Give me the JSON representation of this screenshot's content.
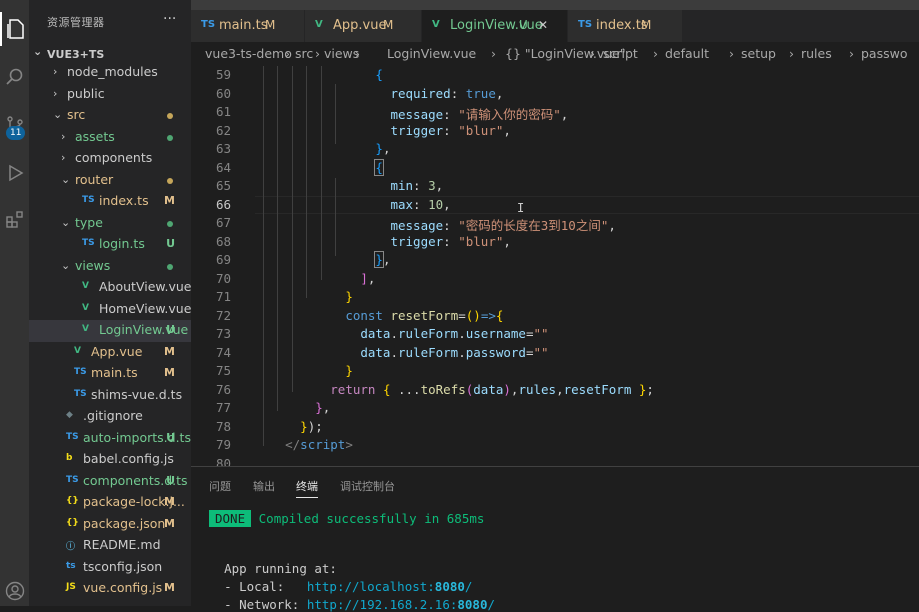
{
  "activity_bar": {
    "scm_badge": "11"
  },
  "sidebar": {
    "title": "资源管理器",
    "more": "···",
    "root": "VUE3+TS",
    "items": [
      {
        "label": "node_modules",
        "chevron": "›",
        "icon": "",
        "icon_color": "",
        "status": "",
        "dot": ""
      },
      {
        "label": "public",
        "chevron": "›",
        "icon": "",
        "icon_color": "",
        "status": "",
        "dot": ""
      },
      {
        "label": "src",
        "chevron": "⌄",
        "icon": "",
        "icon_color": "",
        "status": "",
        "dot": "#c5a65a"
      },
      {
        "label": "assets",
        "chevron": "›",
        "icon": "",
        "icon_color": "",
        "status": "",
        "dot": "#4fa672"
      },
      {
        "label": "components",
        "chevron": "›",
        "icon": "",
        "icon_color": "",
        "status": "",
        "dot": ""
      },
      {
        "label": "router",
        "chevron": "⌄",
        "icon": "",
        "icon_color": "",
        "status": "",
        "dot": "#c5a65a"
      },
      {
        "label": "index.ts",
        "chevron": "",
        "icon": "TS",
        "icon_color": "#3b9be8",
        "status": "M",
        "dot": ""
      },
      {
        "label": "type",
        "chevron": "⌄",
        "icon": "",
        "icon_color": "",
        "status": "",
        "dot": "#4fa672"
      },
      {
        "label": "login.ts",
        "chevron": "",
        "icon": "TS",
        "icon_color": "#3b9be8",
        "status": "U",
        "dot": ""
      },
      {
        "label": "views",
        "chevron": "⌄",
        "icon": "",
        "icon_color": "",
        "status": "",
        "dot": "#4fa672"
      },
      {
        "label": "AboutView.vue",
        "chevron": "",
        "icon": "V",
        "icon_color": "#41b883",
        "status": "",
        "dot": ""
      },
      {
        "label": "HomeView.vue",
        "chevron": "",
        "icon": "V",
        "icon_color": "#41b883",
        "status": "",
        "dot": ""
      },
      {
        "label": "LoginView.vue",
        "chevron": "",
        "icon": "V",
        "icon_color": "#41b883",
        "status": "U",
        "dot": ""
      },
      {
        "label": "App.vue",
        "chevron": "",
        "icon": "V",
        "icon_color": "#41b883",
        "status": "M",
        "dot": ""
      },
      {
        "label": "main.ts",
        "chevron": "",
        "icon": "TS",
        "icon_color": "#3b9be8",
        "status": "M",
        "dot": ""
      },
      {
        "label": "shims-vue.d.ts",
        "chevron": "",
        "icon": "TS",
        "icon_color": "#3b9be8",
        "status": "",
        "dot": ""
      },
      {
        "label": ".gitignore",
        "chevron": "",
        "icon": "◆",
        "icon_color": "#6d8086",
        "status": "",
        "dot": ""
      },
      {
        "label": "auto-imports.d.ts",
        "chevron": "",
        "icon": "TS",
        "icon_color": "#3b9be8",
        "status": "U",
        "dot": ""
      },
      {
        "label": "babel.config.js",
        "chevron": "",
        "icon": "b",
        "icon_color": "#f5de19",
        "status": "",
        "dot": ""
      },
      {
        "label": "components.d.ts",
        "chevron": "",
        "icon": "TS",
        "icon_color": "#3b9be8",
        "status": "U",
        "dot": ""
      },
      {
        "label": "package-lock.j...",
        "chevron": "",
        "icon": "{}",
        "icon_color": "#f5de19",
        "status": "M",
        "dot": ""
      },
      {
        "label": "package.json",
        "chevron": "",
        "icon": "{}",
        "icon_color": "#f5de19",
        "status": "M",
        "dot": ""
      },
      {
        "label": "README.md",
        "chevron": "",
        "icon": "ⓘ",
        "icon_color": "#519aba",
        "status": "",
        "dot": ""
      },
      {
        "label": "tsconfig.json",
        "chevron": "",
        "icon": "ts",
        "icon_color": "#3b9be8",
        "status": "",
        "dot": ""
      },
      {
        "label": "vue.config.js",
        "chevron": "",
        "icon": "JS",
        "icon_color": "#f5de19",
        "status": "M",
        "dot": ""
      }
    ]
  },
  "tabs": [
    {
      "icon": "TS",
      "icon_color": "#3b9be8",
      "label": "main.ts",
      "status": "M",
      "close": ""
    },
    {
      "icon": "V",
      "icon_color": "#41b883",
      "label": "App.vue",
      "status": "M",
      "close": ""
    },
    {
      "icon": "V",
      "icon_color": "#41b883",
      "label": "LoginView.vue",
      "status": "U",
      "close": "✕"
    },
    {
      "icon": "TS",
      "icon_color": "#3b9be8",
      "label": "index.ts",
      "status": "M",
      "close": ""
    }
  ],
  "breadcrumb": [
    "vue3-ts-demo",
    "›",
    "src",
    "›",
    "views",
    "›",
    "LoginView.vue",
    "›",
    "{} \"LoginView.vue\"",
    "›",
    "script",
    "›",
    "default",
    "›",
    "setup",
    "›",
    "rules",
    "›",
    "passwo"
  ],
  "editor": {
    "current_line": "66",
    "lines": [
      "59",
      "60",
      "61",
      "62",
      "63",
      "64",
      "65",
      "66",
      "67",
      "68",
      "69",
      "70",
      "71",
      "72",
      "73",
      "74",
      "75",
      "76",
      "77",
      "78",
      "79",
      "80"
    ]
  },
  "panel": {
    "tabs": [
      "问题",
      "输出",
      "终端",
      "调试控制台"
    ],
    "active_tab": "终端",
    "done_badge": "DONE",
    "compiled": "Compiled successfully in 685ms",
    "app_running": "App running at:",
    "local_label": "- Local:   ",
    "local_url_prefix": "http://localhost:",
    "local_port": "8080",
    "local_url_suffix": "/",
    "network_label": "- Network: ",
    "network_url_prefix": "http://192.168.2.16:",
    "network_port": "8080",
    "network_url_suffix": "/"
  }
}
